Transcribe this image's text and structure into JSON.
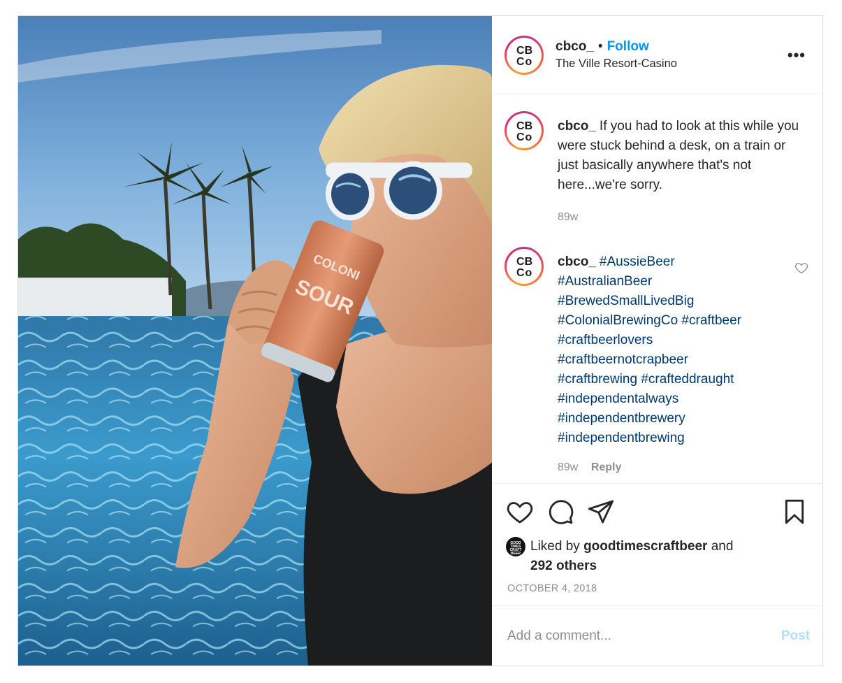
{
  "post": {
    "username": "cbco_",
    "follow_label": "Follow",
    "separator": "•",
    "location": "The Ville Resort-Casino",
    "more_label": "•••",
    "avatar_letters": [
      "C",
      "B",
      "C",
      "o"
    ]
  },
  "caption": {
    "username": "cbco_",
    "text": "If you had to look at this while you were stuck behind a desk, on a train or just basically anywhere that's not here...we're sorry.",
    "time": "89w"
  },
  "comment": {
    "username": "cbco_",
    "hashtag_lines": [
      "#AussieBeer",
      "#AustralianBeer",
      "#BrewedSmallLivedBig",
      "#ColonialBrewingCo #craftbeer",
      "#craftbeerlovers",
      "#craftbeernotcrapbeer",
      "#craftbrewing #crafteddraught",
      "#independentalways",
      "#independentbrewery",
      "#independentbrewing"
    ],
    "time": "89w",
    "reply_label": "Reply"
  },
  "likes": {
    "prefix": "Liked by",
    "liker": "goodtimescraftbeer",
    "and": "and",
    "others": "292 others",
    "liker_avatar_text": "GOOD TIMES CRAFT BEER"
  },
  "date": "OCTOBER 4, 2018",
  "add_comment": {
    "placeholder": "Add a comment...",
    "post_label": "Post"
  },
  "icons": {
    "like": "heart-icon",
    "comment": "comment-bubble-icon",
    "share": "paper-plane-icon",
    "save": "bookmark-icon",
    "comment_like": "small-heart-icon"
  },
  "colors": {
    "follow": "#0095f6",
    "hashtag": "#00376b",
    "muted": "#8e8e8e",
    "post_disabled": "#b2dffc",
    "border": "#dbdbdb"
  }
}
